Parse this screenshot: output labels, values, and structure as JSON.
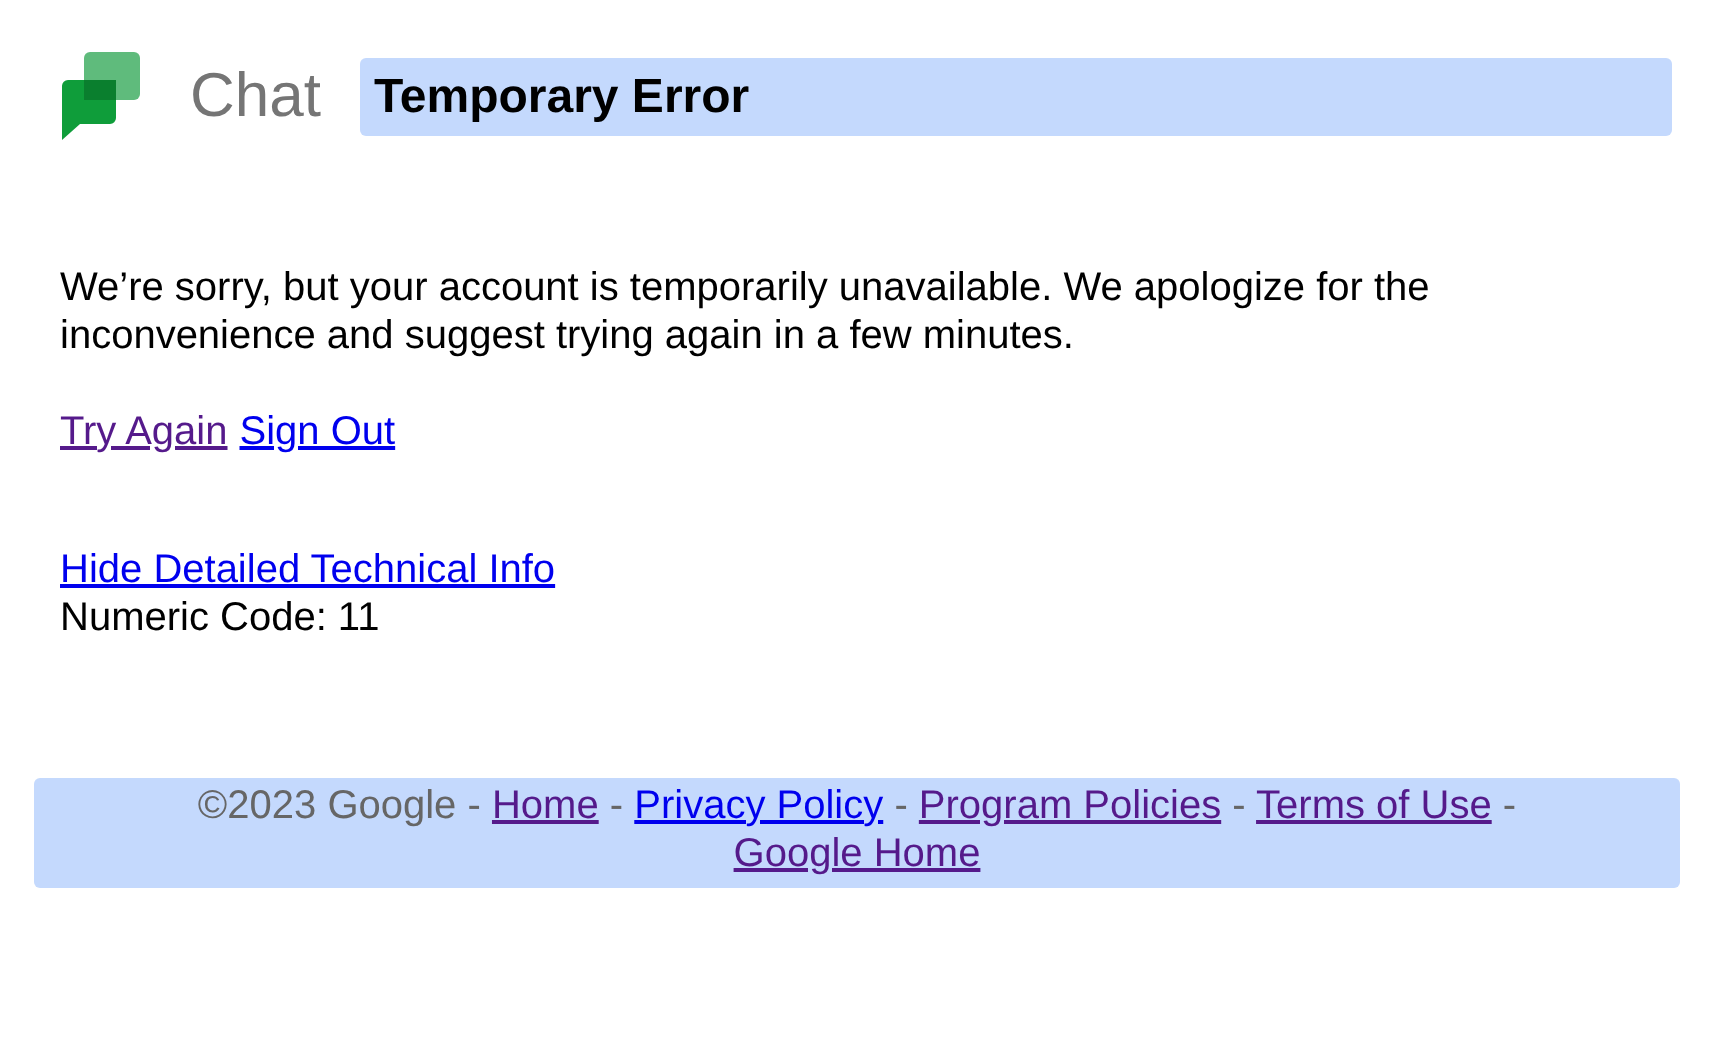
{
  "header": {
    "product": "Chat",
    "title": "Temporary Error"
  },
  "message": "We’re sorry, but your account is temporarily unavailable. We apologize for the inconvenience and suggest trying again in a few minutes.",
  "actions": [
    {
      "label": "Try Again",
      "visited": true
    },
    {
      "label": "Sign Out",
      "visited": false
    }
  ],
  "details": {
    "toggle": {
      "label": "Hide Detailed Technical Info",
      "visited": false
    },
    "code": "Numeric Code: 11"
  },
  "footer": {
    "items": [
      {
        "kind": "text",
        "text": "©2023 Google"
      },
      {
        "kind": "sep",
        "text": "-"
      },
      {
        "kind": "link",
        "text": "Home",
        "visited": true
      },
      {
        "kind": "sep",
        "text": "-"
      },
      {
        "kind": "link",
        "text": "Privacy Policy",
        "visited": false
      },
      {
        "kind": "sep",
        "text": "-"
      },
      {
        "kind": "link",
        "text": "Program Policies",
        "visited": true
      },
      {
        "kind": "sep",
        "text": "-"
      },
      {
        "kind": "link",
        "text": "Terms of Use",
        "visited": true
      },
      {
        "kind": "sep",
        "text": "-"
      },
      {
        "kind": "link",
        "text": "Google Home",
        "visited": true
      }
    ]
  }
}
